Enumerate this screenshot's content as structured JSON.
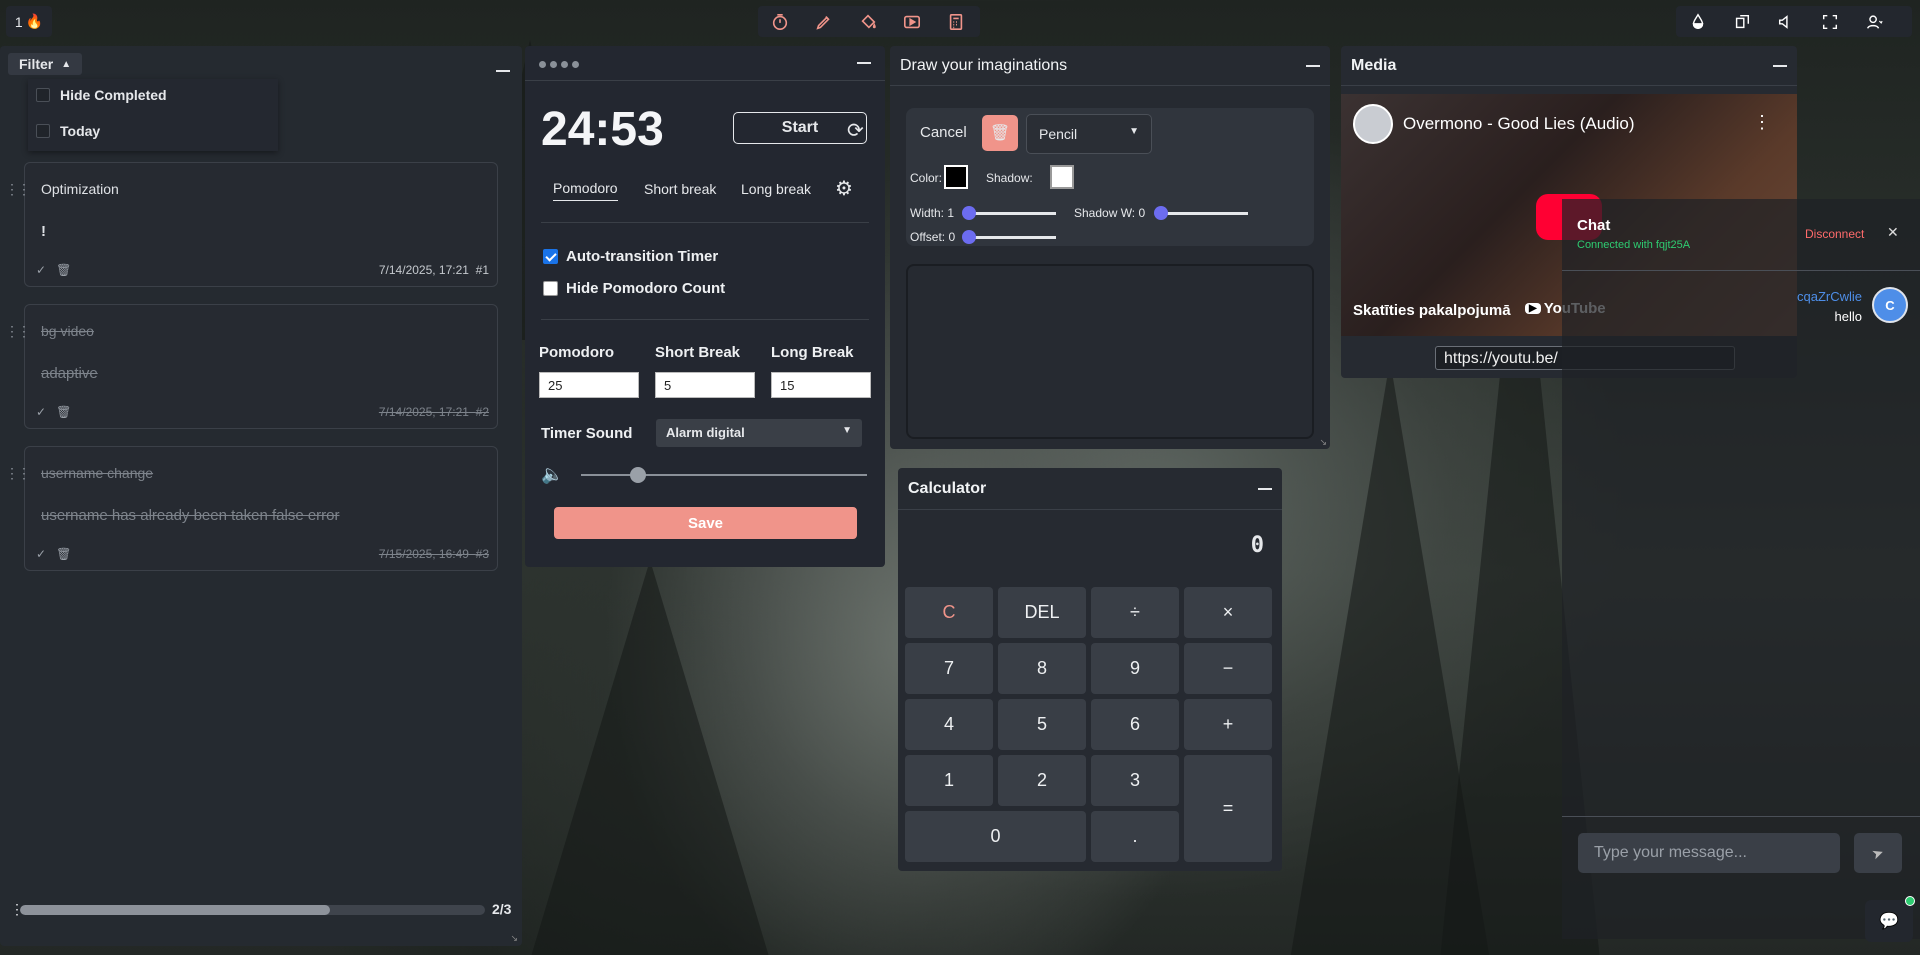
{
  "streak": {
    "count": "1",
    "icon": "fire-icon"
  },
  "toolbar": {
    "tools": [
      "timer-icon",
      "pencil-icon",
      "paint-bucket-icon",
      "play-video-icon",
      "calculator-icon"
    ],
    "right_tools": [
      "theme-drop-icon",
      "layout-icon",
      "volume-icon",
      "fullscreen-icon",
      "user-icon"
    ]
  },
  "tasks": {
    "filter_label": "Filter",
    "filters": [
      {
        "label": "Hide Completed",
        "checked": false
      },
      {
        "label": "Today",
        "checked": false
      }
    ],
    "items": [
      {
        "title": "Optimization",
        "desc": "!",
        "date": "7/14/2025, 17:21",
        "num": "#1",
        "done": false
      },
      {
        "title": "bg video",
        "desc": "adaptive",
        "date": "7/14/2025, 17:21",
        "num": "#2",
        "done": true
      },
      {
        "title": "username change",
        "desc": "username has already been taken false error",
        "date": "7/15/2025, 16:49",
        "num": "#3",
        "done": true
      }
    ],
    "progress_text": "2/3",
    "progress_value": 0.667
  },
  "pomodoro": {
    "time": "24:53",
    "start_label": "Start",
    "tabs": [
      "Pomodoro",
      "Short break",
      "Long break"
    ],
    "auto_transition_label": "Auto-transition Timer",
    "auto_transition": true,
    "hide_count_label": "Hide Pomodoro Count",
    "hide_count": false,
    "pomodoro_label": "Pomodoro",
    "pomodoro_value": "25",
    "short_label": "Short Break",
    "short_value": "5",
    "long_label": "Long Break",
    "long_value": "15",
    "sound_label": "Timer Sound",
    "sound_value": "Alarm digital",
    "volume": 0.2,
    "save_label": "Save"
  },
  "draw": {
    "title": "Draw your imaginations",
    "cancel_label": "Cancel",
    "tool_value": "Pencil",
    "color_label": "Color:",
    "shadow_label": "Shadow:",
    "width_label": "Width: 1",
    "shadow_w_label": "Shadow W: 0",
    "offset_label": "Offset: 0",
    "color": "#000000",
    "shadow_color": "#ffffff"
  },
  "media": {
    "title": "Media",
    "video_title": "Overmono - Good Lies (Audio)",
    "watch_later": "Skatīties pakalpojumā",
    "yt_label": "YouTube",
    "url": "https://youtu.be/"
  },
  "calculator": {
    "title": "Calculator",
    "display": "0",
    "keys": [
      "C",
      "DEL",
      "÷",
      "×",
      "7",
      "8",
      "9",
      "−",
      "4",
      "5",
      "6",
      "+",
      "1",
      "2",
      "3",
      "=",
      "0",
      "."
    ]
  },
  "chat": {
    "title": "Chat",
    "status": "Connected with fqjt25A",
    "disconnect_label": "Disconnect",
    "messages": [
      {
        "user": "cqaZrCwlie",
        "avatar": "C",
        "text": "hello"
      }
    ],
    "input_placeholder": "Type your message..."
  },
  "colors": {
    "accent": "#f0948a",
    "panel": "#262a31",
    "link": "#4e8ee8",
    "status_green": "#2ecc71",
    "disconnect": "#ff6b6b"
  }
}
